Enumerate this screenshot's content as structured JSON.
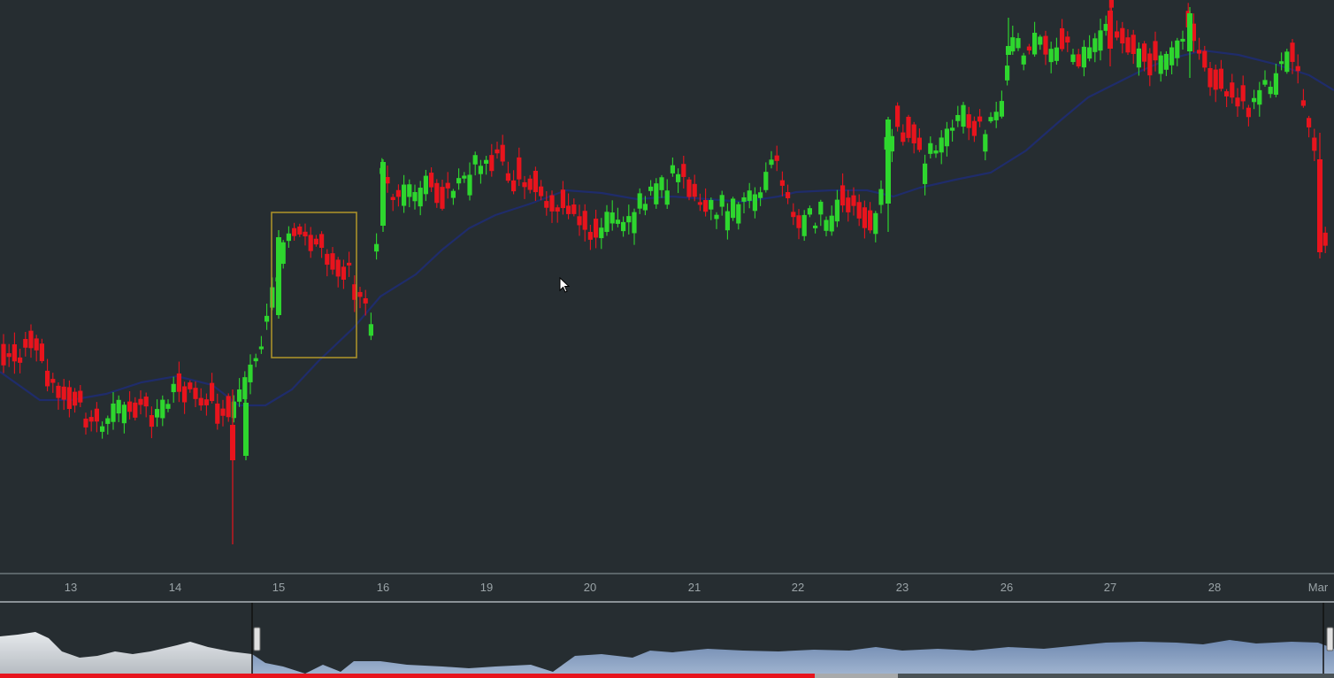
{
  "chart_data": {
    "type": "candlestick",
    "x_ticks": [
      "13",
      "14",
      "15",
      "16",
      "19",
      "20",
      "21",
      "22",
      "23",
      "26",
      "27",
      "28",
      "Mar"
    ],
    "highlight_box": true,
    "moving_average": true,
    "colors": {
      "up": "#2ed62e",
      "down": "#e8141d",
      "ma": "#1f2c6b",
      "box": "#a88f2a",
      "background": "#262d31"
    }
  },
  "video_progress": {
    "played": 0.611,
    "buffered": 0.673
  }
}
